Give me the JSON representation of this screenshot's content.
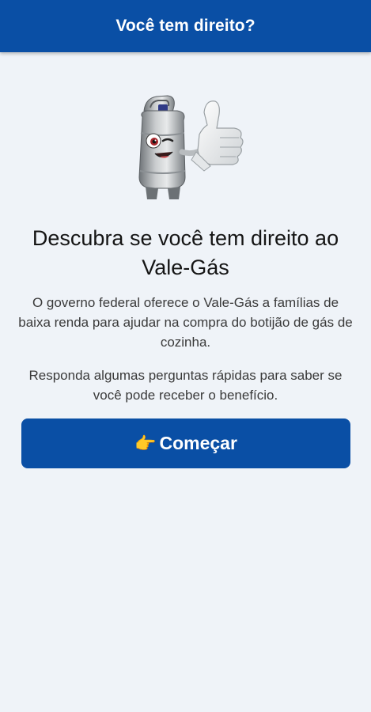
{
  "header": {
    "title": "Você tem direito?"
  },
  "hero": {
    "illustration": "gas-cylinder-mascot-thumbs-up"
  },
  "main": {
    "headline": "Descubra se você tem direito ao Vale-Gás",
    "paragraph_1": "O governo federal oferece o Vale-Gás a famílias de baixa renda para ajudar na compra do botijão de gás de cozinha.",
    "paragraph_2": "Responda algumas perguntas rápidas para saber se você pode receber o benefício."
  },
  "cta": {
    "emoji": "👉",
    "icon": "pointing-hand-icon",
    "label": "Começar"
  },
  "colors": {
    "brand": "#0a4fa5",
    "background": "#eff3f8"
  }
}
